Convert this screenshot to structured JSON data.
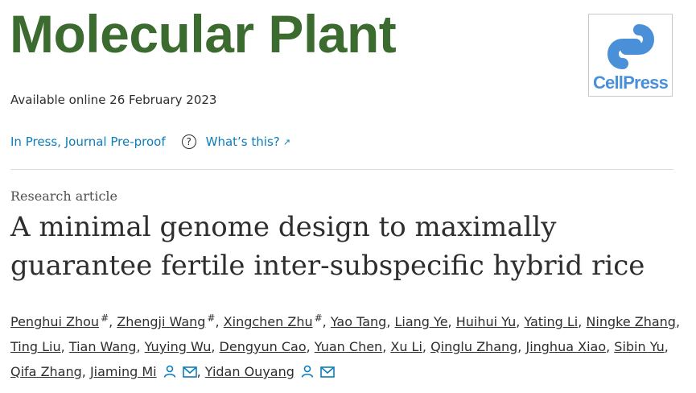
{
  "journal": {
    "name": "Molecular Plant"
  },
  "publisher_logo": {
    "text": "CellPress",
    "color": "#4a90d9"
  },
  "available_online": "Available online 26 February 2023",
  "status": {
    "label": "In Press, Journal Pre-proof",
    "help_link": "What’s this?"
  },
  "article": {
    "type": "Research article",
    "title_line1": "A minimal genome design to maximally",
    "title_line2": "guarantee fertile inter-subspecific hybrid rice"
  },
  "authors": [
    {
      "name": "Penghui Zhou",
      "mark": "#"
    },
    {
      "name": "Zhengji Wang",
      "mark": "#"
    },
    {
      "name": "Xingchen Zhu",
      "mark": "#"
    },
    {
      "name": "Yao Tang"
    },
    {
      "name": "Liang Ye"
    },
    {
      "name": "Huihui Yu"
    },
    {
      "name": "Yating Li"
    },
    {
      "name": "Ningke Zhang"
    },
    {
      "name": "Ting Liu"
    },
    {
      "name": "Tian Wang"
    },
    {
      "name": "Yuying Wu"
    },
    {
      "name": "Dengyun Cao"
    },
    {
      "name": "Yuan Chen"
    },
    {
      "name": "Xu Li"
    },
    {
      "name": "Qinglu Zhang"
    },
    {
      "name": "Jinghua Xiao"
    },
    {
      "name": "Sibin Yu"
    },
    {
      "name": "Qifa Zhang"
    },
    {
      "name": "Jiaming Mi",
      "icons": [
        "person-icon",
        "email-icon"
      ]
    },
    {
      "name": "Yidan Ouyang",
      "icons": [
        "person-icon",
        "email-icon"
      ]
    }
  ],
  "colors": {
    "journal_green": "#3b6b2e",
    "link_blue": "#0c7dbb",
    "icon_blue": "#0c7dbb"
  }
}
